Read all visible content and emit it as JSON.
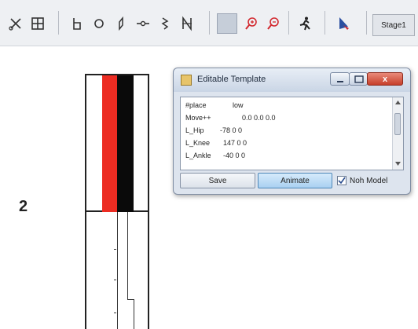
{
  "toolbar": {
    "icons": [
      "scissors-icon",
      "grid-icon",
      "d-symbol-icon",
      "circle-icon",
      "pen-icon",
      "connector-icon",
      "flag-icon",
      "zigzag-icon",
      "grid-toggle-icon",
      "zoom-in-icon",
      "zoom-out-icon",
      "figure-run-icon",
      "cursor-arrow-icon"
    ],
    "stage_label": "Stage1"
  },
  "canvas": {
    "row_label": "2"
  },
  "template_window": {
    "title": "Editable Template",
    "lines": [
      {
        "key": "#place",
        "value": "low"
      },
      {
        "key": "Move++",
        "value": "0.0 0.0 0.0"
      },
      {
        "key": "L_Hip",
        "value": "-78 0 0"
      },
      {
        "key": "L_Knee",
        "value": "147 0 0"
      },
      {
        "key": "L_Ankle",
        "value": "-40 0 0"
      }
    ],
    "save_label": "Save",
    "animate_label": "Animate",
    "checkbox_label": "Noh Model",
    "checkbox_checked": true,
    "close_glyph": "x"
  }
}
